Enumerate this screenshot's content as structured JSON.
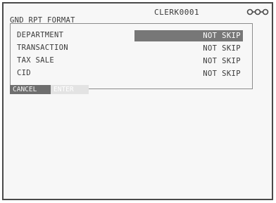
{
  "header": {
    "clerk_id": "CLERK0001",
    "status_icon": "connection-icon"
  },
  "panel": {
    "title": "GND RPT FORMAT",
    "rows": [
      {
        "label": "DEPARTMENT",
        "value": "NOT SKIP",
        "selected": true
      },
      {
        "label": "TRANSACTION",
        "value": "NOT SKIP",
        "selected": false
      },
      {
        "label": "TAX SALE",
        "value": "NOT SKIP",
        "selected": false
      },
      {
        "label": "CID",
        "value": "NOT SKIP",
        "selected": false
      }
    ]
  },
  "softkeys": {
    "cancel_label": "CANCEL",
    "enter_label": "ENTER"
  },
  "colors": {
    "selection": "#777777",
    "text": "#3a3a3a",
    "background": "#f7f7f7"
  }
}
